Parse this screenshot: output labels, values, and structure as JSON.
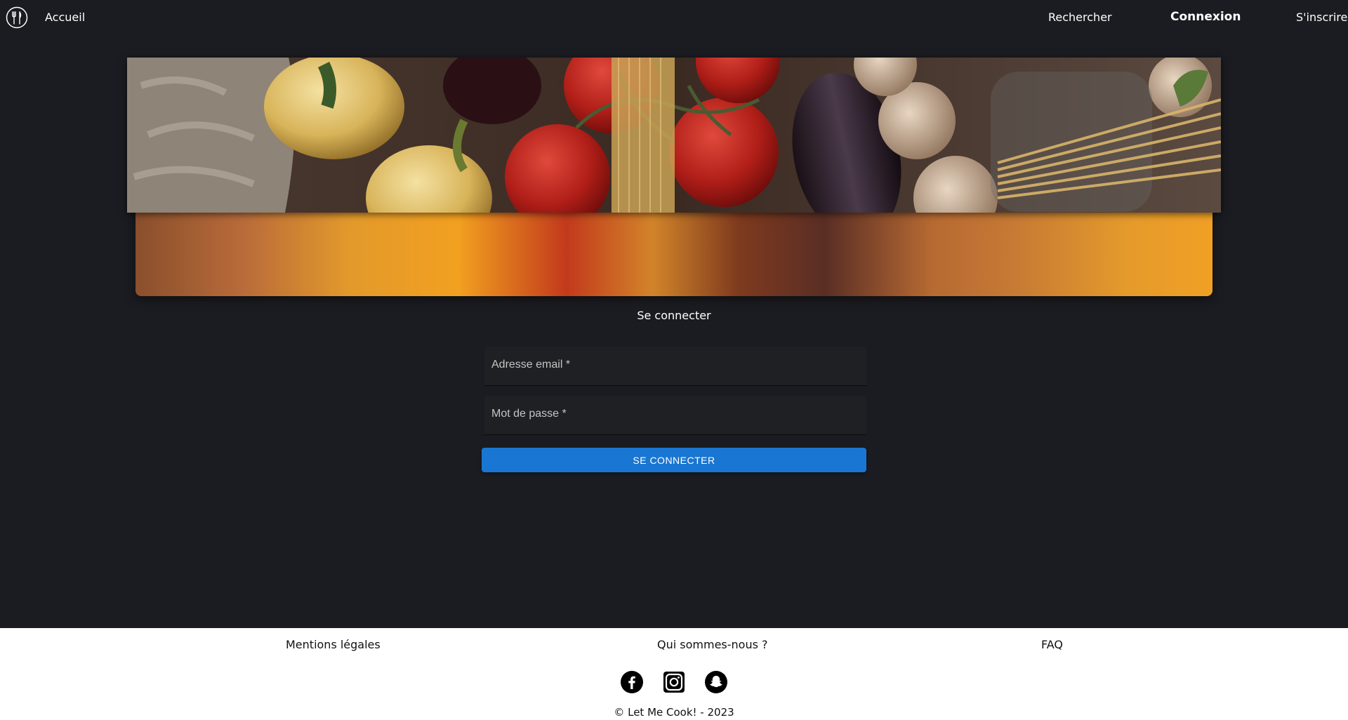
{
  "nav": {
    "logo_icon": "utensils-circle-icon",
    "home_label": "Accueil",
    "search_label": "Rechercher",
    "login_label": "Connexion",
    "signup_label": "S'inscrire"
  },
  "hero": {
    "image": "vegetables-banner-image"
  },
  "login": {
    "title": "Se connecter",
    "email_label": "Adresse email *",
    "password_label": "Mot de passe *",
    "submit_label": "SE CONNECTER"
  },
  "footer": {
    "links": {
      "legal": "Mentions légales",
      "about": "Qui sommes-nous ?",
      "faq": "FAQ"
    },
    "social": [
      "facebook-icon",
      "instagram-icon",
      "snapchat-icon"
    ],
    "copyright": "© Let Me Cook! - 2023"
  },
  "colors": {
    "background": "#1b1c21",
    "accent": "#1976d2",
    "footer": "#ffffff"
  }
}
